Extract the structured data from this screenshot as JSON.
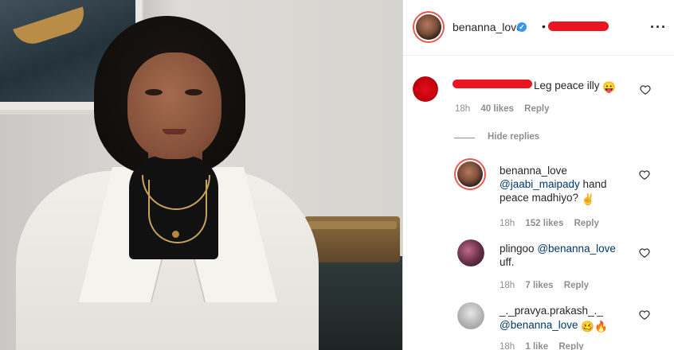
{
  "header": {
    "username": "benanna_love",
    "separator": "•",
    "more_icon": "more-horizontal-icon"
  },
  "comment": {
    "text": "Leg peace illy",
    "emoji": "😛",
    "time": "18h",
    "likes": "40 likes",
    "reply": "Reply"
  },
  "hide_replies": "Hide replies",
  "replies": [
    {
      "username": "benanna_love",
      "mention": "@jaabi_maipady",
      "text_line1": " hand",
      "text_line2": "peace madhiyo?",
      "emoji": "✌",
      "time": "18h",
      "likes": "152 likes",
      "reply": "Reply"
    },
    {
      "username": "plingoo",
      "mention": "@benanna_love",
      "text_line2": "uff.",
      "time": "18h",
      "likes": "7 likes",
      "reply": "Reply"
    },
    {
      "username": "_._pravya.prakash_._",
      "mention": "@benanna_love",
      "emoji": "🥴🔥",
      "time": "18h",
      "likes": "1 like",
      "reply": "Reply"
    }
  ],
  "colors": {
    "redaction": "#ea1520",
    "verified": "#3897f0",
    "mention": "#00376b",
    "meta": "#8e8e8e"
  }
}
